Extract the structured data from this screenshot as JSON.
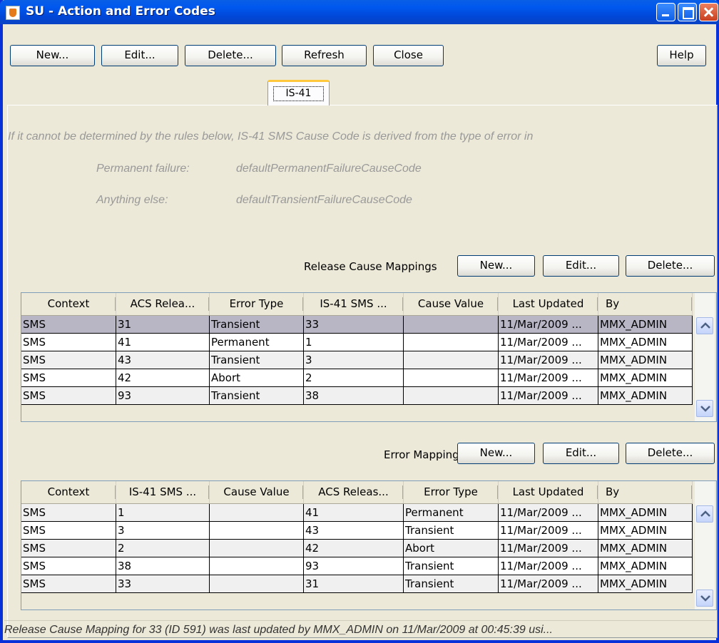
{
  "window": {
    "title": "SU - Action and Error Codes"
  },
  "toolbar": {
    "new_label": "New...",
    "edit_label": "Edit...",
    "delete_label": "Delete...",
    "refresh_label": "Refresh",
    "close_label": "Close",
    "help_label": "Help"
  },
  "tab": {
    "label": "IS-41"
  },
  "info": {
    "intro": "If it cannot be determined by the rules below, IS-41 SMS Cause Code is derived from the type of error in",
    "permanent_label": "Permanent failure:",
    "permanent_value": "defaultPermanentFailureCauseCode",
    "else_label": "Anything else:",
    "else_value": "defaultTransientFailureCauseCode"
  },
  "release": {
    "label": "Release Cause Mappings",
    "new_label": "New...",
    "edit_label": "Edit...",
    "delete_label": "Delete...",
    "columns": [
      "Context",
      "ACS Relea...",
      "Error Type",
      "IS-41 SMS ...",
      "Cause Value",
      "Last Updated",
      "By"
    ],
    "rows": [
      [
        "SMS",
        "31",
        "Transient",
        "33",
        "",
        "11/Mar/2009 ...",
        "MMX_ADMIN"
      ],
      [
        "SMS",
        "41",
        "Permanent",
        "1",
        "",
        "11/Mar/2009 ...",
        "MMX_ADMIN"
      ],
      [
        "SMS",
        "43",
        "Transient",
        "3",
        "",
        "11/Mar/2009 ...",
        "MMX_ADMIN"
      ],
      [
        "SMS",
        "42",
        "Abort",
        "2",
        "",
        "11/Mar/2009 ...",
        "MMX_ADMIN"
      ],
      [
        "SMS",
        "93",
        "Transient",
        "38",
        "",
        "11/Mar/2009 ...",
        "MMX_ADMIN"
      ]
    ]
  },
  "error": {
    "label": "Error Mappings",
    "new_label": "New...",
    "edit_label": "Edit...",
    "delete_label": "Delete...",
    "columns": [
      "Context",
      "IS-41 SMS ...",
      "Cause Value",
      "ACS Releas...",
      "Error Type",
      "Last Updated",
      "By"
    ],
    "rows": [
      [
        "SMS",
        "1",
        "",
        "41",
        "Permanent",
        "11/Mar/2009 ...",
        "MMX_ADMIN"
      ],
      [
        "SMS",
        "3",
        "",
        "43",
        "Transient",
        "11/Mar/2009 ...",
        "MMX_ADMIN"
      ],
      [
        "SMS",
        "2",
        "",
        "42",
        "Abort",
        "11/Mar/2009 ...",
        "MMX_ADMIN"
      ],
      [
        "SMS",
        "38",
        "",
        "93",
        "Transient",
        "11/Mar/2009 ...",
        "MMX_ADMIN"
      ],
      [
        "SMS",
        "33",
        "",
        "31",
        "Transient",
        "11/Mar/2009 ...",
        "MMX_ADMIN"
      ]
    ]
  },
  "status": {
    "text": "Release Cause Mapping for 33 (ID 591) was last updated by MMX_ADMIN on 11/Mar/2009 at 00:45:39 usi..."
  }
}
